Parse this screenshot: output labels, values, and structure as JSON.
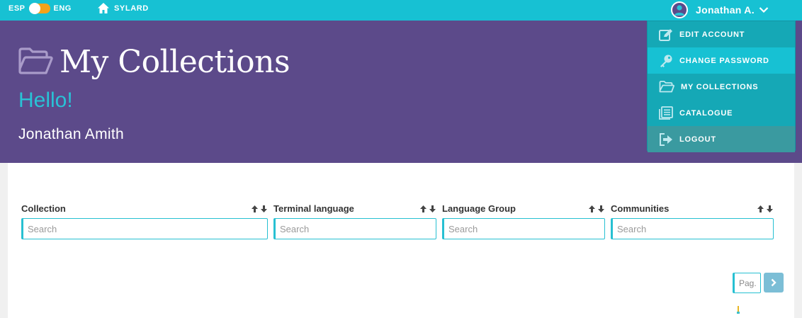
{
  "topbar": {
    "lang_left": "ESP",
    "lang_right": "ENG",
    "home_label": "SYLARD",
    "user_name": "Jonathan A."
  },
  "header": {
    "title": "My Collections",
    "greeting": "Hello!",
    "full_name": "Jonathan Amith"
  },
  "dropdown": {
    "items": [
      {
        "label": "EDIT ACCOUNT",
        "icon": "edit-icon"
      },
      {
        "label": "CHANGE PASSWORD",
        "icon": "key-icon"
      },
      {
        "label": "MY COLLECTIONS",
        "icon": "folder-open-icon"
      },
      {
        "label": "CATALOGUE",
        "icon": "catalogue-icon"
      },
      {
        "label": "LOGOUT",
        "icon": "logout-icon"
      }
    ]
  },
  "table": {
    "columns": [
      {
        "header": "Collection",
        "placeholder": "Search"
      },
      {
        "header": "Terminal language",
        "placeholder": "Search"
      },
      {
        "header": "Language Group",
        "placeholder": "Search"
      },
      {
        "header": "Communities",
        "placeholder": "Search"
      }
    ]
  },
  "pagination": {
    "placeholder": "Pag."
  },
  "colors": {
    "topbar": "#17c1d3",
    "header": "#5c4a8a",
    "accent": "#29c2d6",
    "toggle": "#f2a21a",
    "dropdown": "#15a8b6"
  }
}
